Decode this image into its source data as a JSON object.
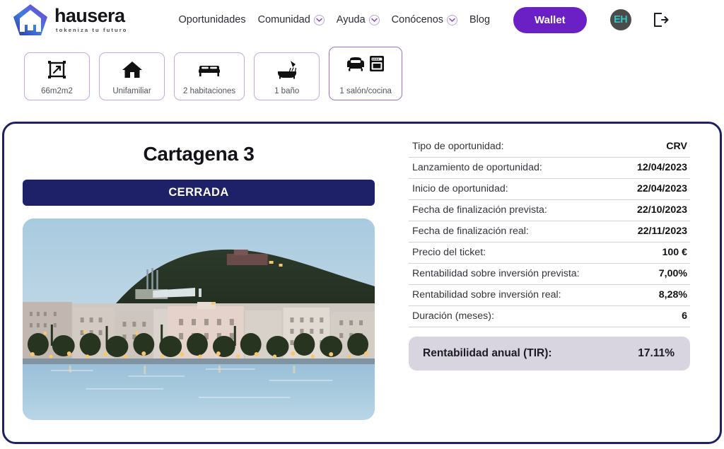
{
  "brand": {
    "name": "hausera",
    "tagline": "tokeniza tu futuro",
    "logo_icon": "house-pentagon-logo"
  },
  "nav": {
    "items": [
      {
        "label": "Oportunidades",
        "has_dropdown": false
      },
      {
        "label": "Comunidad",
        "has_dropdown": true
      },
      {
        "label": "Ayuda",
        "has_dropdown": true
      },
      {
        "label": "Conócenos",
        "has_dropdown": true
      },
      {
        "label": "Blog",
        "has_dropdown": false
      }
    ],
    "wallet_label": "Wallet",
    "avatar_initials": "EH",
    "logout_icon": "logout-icon"
  },
  "features": [
    {
      "icon": "area-resize-icon",
      "label": "66m2m2"
    },
    {
      "icon": "house-icon",
      "label": "Unifamiliar"
    },
    {
      "icon": "bed-icon",
      "label": "2 habitaciones"
    },
    {
      "icon": "bathtub-shower-icon",
      "label": "1 baño"
    },
    {
      "icon": "sofa-oven-icon",
      "label": "1 salón/cocina"
    }
  ],
  "property": {
    "title": "Cartagena 3",
    "status": "CERRADA",
    "photo_alt": "cartagena-harbour-dusk-photo"
  },
  "details": [
    {
      "label": "Tipo de oportunidad:",
      "value": "CRV"
    },
    {
      "label": "Lanzamiento de oportunidad:",
      "value": "12/04/2023"
    },
    {
      "label": "Inicio de oportunidad:",
      "value": "22/04/2023"
    },
    {
      "label": "Fecha de finalización prevista:",
      "value": "22/10/2023"
    },
    {
      "label": "Fecha de finalización real:",
      "value": "22/11/2023"
    },
    {
      "label": "Precio del ticket:",
      "value": "100 €"
    },
    {
      "label": "Rentabilidad sobre inversión prevista:",
      "value": "7,00%"
    },
    {
      "label": "Rentabilidad sobre inversión real:",
      "value": "8,28%"
    },
    {
      "label": "Duración (meses):",
      "value": "6"
    }
  ],
  "highlight": {
    "label": "Rentabilidad anual (TIR):",
    "value": "17.11%"
  },
  "colors": {
    "brand_purple": "#6a20c5",
    "navy": "#1e2168",
    "card_border_purple": "#c4a7e7",
    "highlight_bg": "#d9d5e0",
    "avatar_teal": "#2ec4c4"
  }
}
